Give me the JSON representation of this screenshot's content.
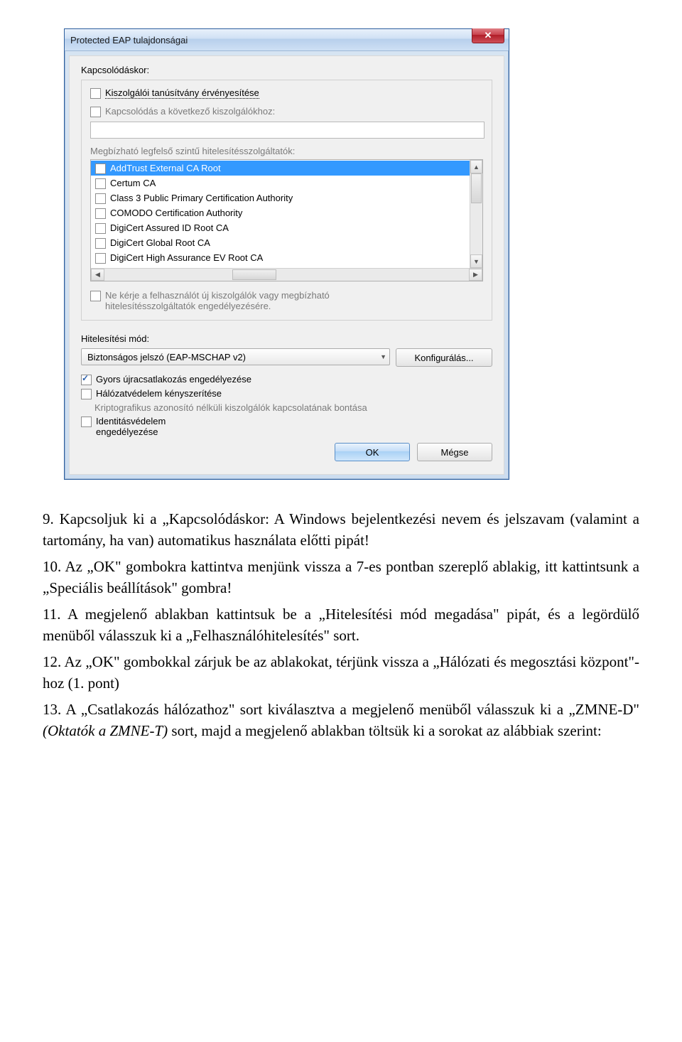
{
  "dialog": {
    "title": "Protected EAP tulajdonságai",
    "close_glyph": "✕",
    "connect_label": "Kapcsolódáskor:",
    "validate_cert": "Kiszolgálói tanúsítvány érvényesítése",
    "connect_servers": "Kapcsolódás a következő kiszolgálókhoz:",
    "trusted_ca_label": "Megbízható legfelső szintű hitelesítésszolgáltatók:",
    "ca_list": [
      "AddTrust External CA Root",
      "Certum CA",
      "Class 3 Public Primary Certification Authority",
      "COMODO Certification Authority",
      "DigiCert Assured ID Root CA",
      "DigiCert Global Root CA",
      "DigiCert High Assurance EV Root CA"
    ],
    "noprompt_line1": "Ne kérje a felhasználót új kiszolgálók vagy megbízható",
    "noprompt_line2": "hitelesítésszolgáltatók engedélyezésére.",
    "auth_method_label": "Hitelesítési mód:",
    "auth_method_value": "Biztonságos jelszó (EAP-MSCHAP v2)",
    "configure_btn": "Konfigurálás...",
    "opt_fast_reconnect": "Gyors újracsatlakozás engedélyezése",
    "opt_nap": "Hálózatvédelem kényszerítése",
    "opt_crypto": "Kriptografikus azonosító nélküli kiszolgálók kapcsolatának bontása",
    "opt_identity_l1": "Identitásvédelem",
    "opt_identity_l2": "engedélyezése",
    "ok_btn": "OK",
    "cancel_btn": "Mégse"
  },
  "doc": {
    "p9": "9. Kapcsoljuk ki a „Kapcsolódáskor: A Windows bejelentkezési nevem és jelszavam (valamint a tartomány, ha van) automatikus használata előtti pipát!",
    "p10": "10. Az „OK\" gombokra kattintva menjünk vissza a 7-es pontban szereplő ablakig, itt kattintsunk a „Speciális beállítások\" gombra!",
    "p11": "11. A megjelenő ablakban kattintsuk be a „Hitelesítési mód megadása\" pipát, és a legördülő menüből válasszuk ki a „Felhasználóhitelesítés\" sort.",
    "p12": "12. Az „OK\" gombokkal zárjuk be az ablakokat, térjünk vissza a „Hálózati és megosztási központ\"-hoz (1. pont)",
    "p13_a": "13. A „Csatlakozás hálózathoz\" sort kiválasztva a megjelenő menüből válasszuk ki a „ZMNE-D\" ",
    "p13_em": "(Oktatók a ZMNE-T)",
    "p13_b": " sort, majd a megjelenő ablakban töltsük ki a sorokat az alábbiak szerint:"
  }
}
